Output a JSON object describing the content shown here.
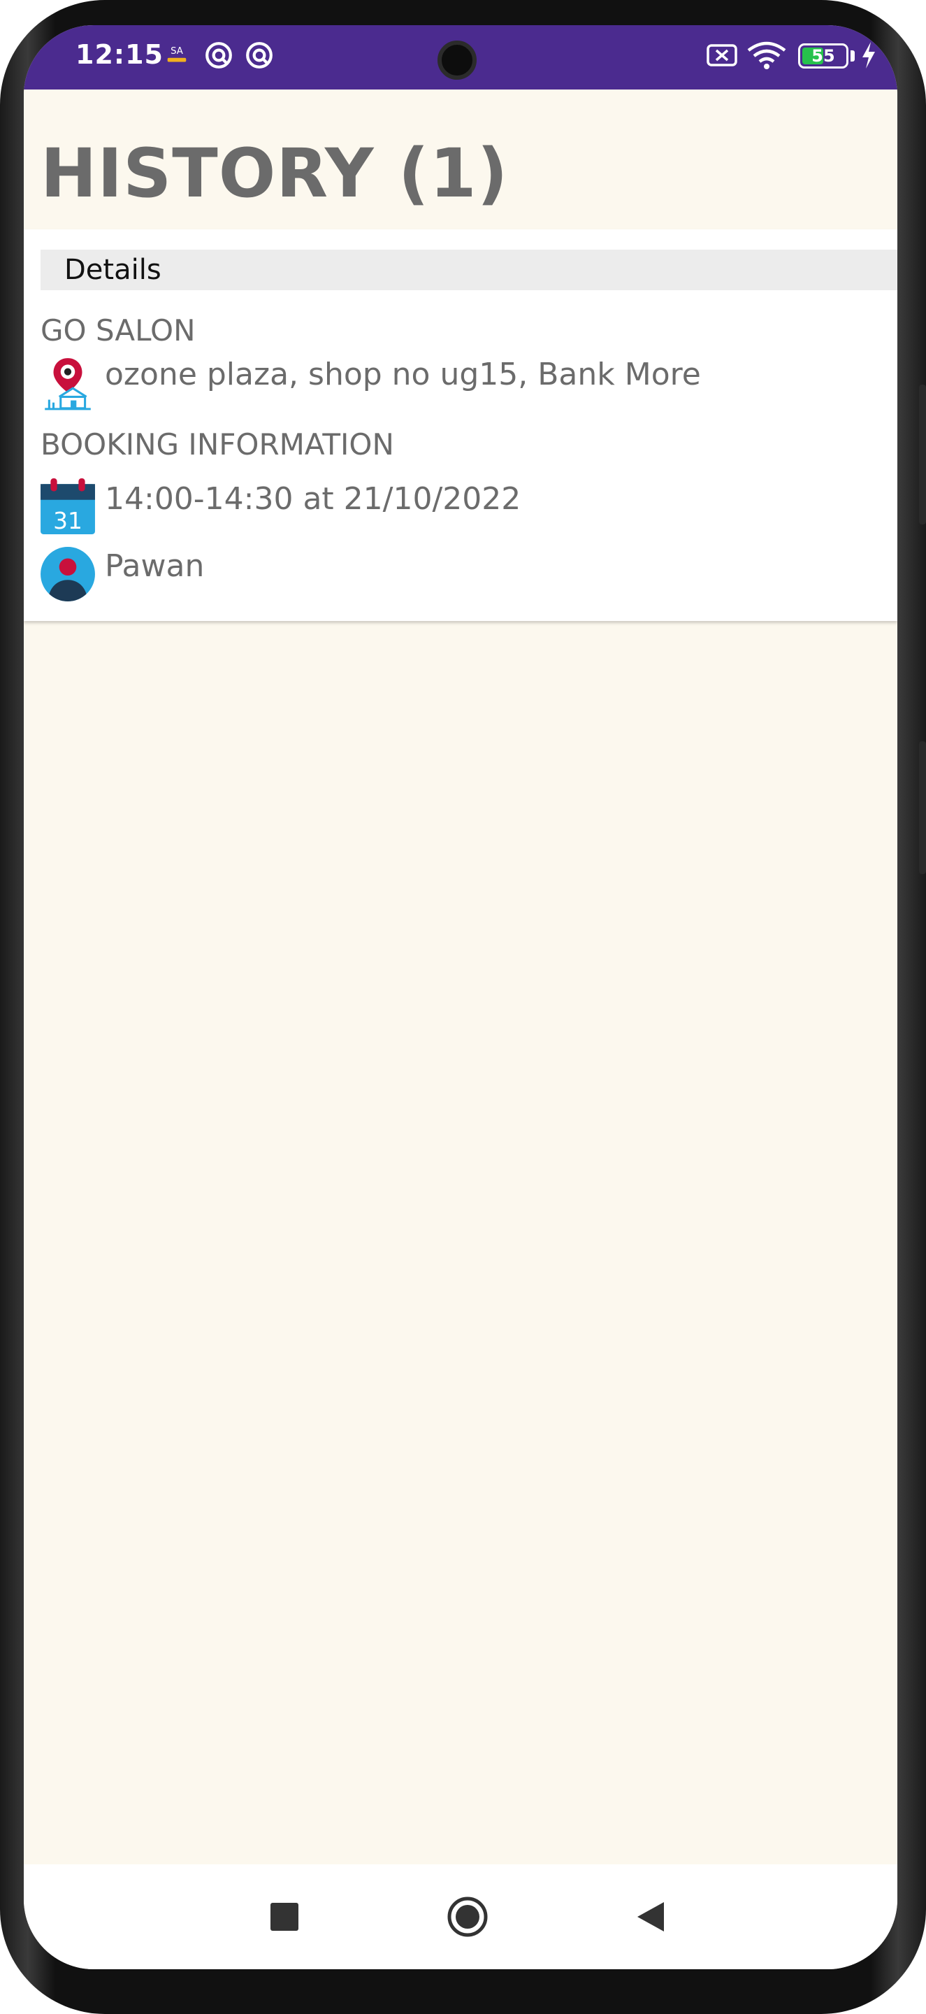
{
  "status_bar": {
    "time": "12:15",
    "battery_level": "55",
    "battery_fraction": 0.55,
    "left_icons": [
      "app-notification-icon",
      "notification-icon",
      "notification-icon"
    ],
    "right_icons": [
      "no-sim-icon",
      "wifi-icon",
      "battery-icon",
      "charging-icon"
    ]
  },
  "header": {
    "title": "HISTORY (1)"
  },
  "history": {
    "details_label": "Details",
    "salon_name": "GO SALON",
    "address": "ozone plaza, shop no ug15, Bank More",
    "booking_section_label": "BOOKING INFORMATION",
    "booking_time": "14:00-14:30 at 21/10/2022",
    "customer_name": "Pawan",
    "calendar_day": "31"
  },
  "nav_bar": {
    "buttons": [
      "recents-icon",
      "home-icon",
      "back-icon"
    ]
  },
  "colors": {
    "status_bar": "#4b2b8f",
    "background": "#fcf8ee",
    "text_gray": "#6b6b6b",
    "details_bar": "#ececec",
    "battery_green": "#27c24c",
    "calendar_blue": "#29a8e0",
    "pin_red": "#c8103c"
  }
}
